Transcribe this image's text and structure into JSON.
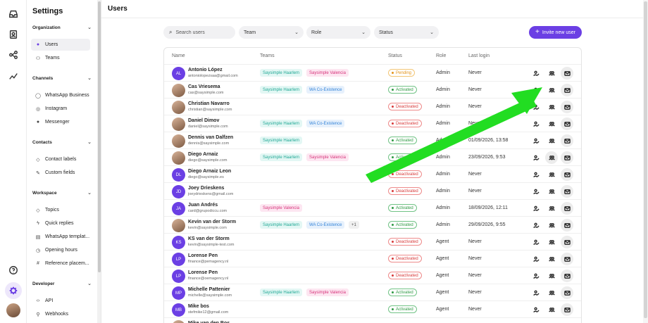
{
  "sidebar": {
    "title": "Settings",
    "sections": [
      {
        "label": "Organization",
        "items": [
          {
            "label": "Users",
            "icon": "user-icon"
          },
          {
            "label": "Teams",
            "icon": "team-icon"
          }
        ]
      },
      {
        "label": "Channels",
        "items": [
          {
            "label": "WhatsApp Business",
            "icon": "whatsapp-icon"
          },
          {
            "label": "Instagram",
            "icon": "instagram-icon"
          },
          {
            "label": "Messenger",
            "icon": "messenger-icon"
          }
        ]
      },
      {
        "label": "Contacts",
        "items": [
          {
            "label": "Contact labels",
            "icon": "tag-icon"
          },
          {
            "label": "Custom fields",
            "icon": "edit-icon"
          }
        ]
      },
      {
        "label": "Workspace",
        "items": [
          {
            "label": "Topics",
            "icon": "tag-icon"
          },
          {
            "label": "Quick replies",
            "icon": "bolt-icon"
          },
          {
            "label": "WhatsApp templat...",
            "icon": "template-icon"
          },
          {
            "label": "Opening hours",
            "icon": "clock-icon"
          },
          {
            "label": "Reference placem...",
            "icon": "hash-icon"
          }
        ]
      },
      {
        "label": "Developer",
        "items": [
          {
            "label": "API",
            "icon": "code-icon"
          },
          {
            "label": "Webhooks",
            "icon": "webhook-icon"
          }
        ]
      }
    ]
  },
  "main": {
    "title": "Users",
    "search_placeholder": "Search users",
    "filters": [
      "Team",
      "Role",
      "Status"
    ],
    "invite_label": "Invite new user",
    "columns": {
      "name": "Name",
      "teams": "Teams",
      "status": "Status",
      "role": "Role",
      "last_login": "Last login"
    }
  },
  "users": [
    {
      "initials": "AL",
      "photo": false,
      "name": "Antonio López",
      "email": "antoniolopezsaa@gmail.com",
      "teams": [
        {
          "label": "Saysimple Haarlem",
          "color": "teal"
        },
        {
          "label": "Saysimple Valencia",
          "color": "pink"
        }
      ],
      "status": "Pending",
      "status_kind": "pend",
      "role": "Admin",
      "last_login": "Never"
    },
    {
      "initials": "",
      "photo": true,
      "name": "Cas Vriesema",
      "email": "cas@saysimple.com",
      "teams": [
        {
          "label": "Saysimple Haarlem",
          "color": "teal"
        },
        {
          "label": "WA Co-Existence",
          "color": "blue"
        }
      ],
      "status": "Activated",
      "status_kind": "act",
      "role": "Admin",
      "last_login": "Never"
    },
    {
      "initials": "",
      "photo": true,
      "name": "Christian Navarro",
      "email": "christian@saysimple.com",
      "teams": [],
      "status": "Deactivated",
      "status_kind": "deact",
      "role": "Admin",
      "last_login": "Never"
    },
    {
      "initials": "",
      "photo": true,
      "name": "Daniel Dimov",
      "email": "daniel@saysimple.com",
      "teams": [
        {
          "label": "Saysimple Haarlem",
          "color": "teal"
        },
        {
          "label": "WA Co-Existence",
          "color": "blue"
        }
      ],
      "status": "Deactivated",
      "status_kind": "deact",
      "role": "Admin",
      "last_login": "Never"
    },
    {
      "initials": "",
      "photo": true,
      "name": "Dennis van Dalfzen",
      "email": "dennis@saysimple.com",
      "teams": [
        {
          "label": "Saysimple Haarlem",
          "color": "teal"
        }
      ],
      "status": "Activated",
      "status_kind": "act",
      "role": "Admin",
      "last_login": "01/09/2026, 13:58"
    },
    {
      "initials": "",
      "photo": true,
      "name": "Diego Arnaiz",
      "email": "diego@saysimple.com",
      "teams": [
        {
          "label": "Saysimple Haarlem",
          "color": "teal"
        },
        {
          "label": "Saysimple Valencia",
          "color": "pink"
        }
      ],
      "status": "Activated",
      "status_kind": "act",
      "role": "Admin",
      "last_login": "23/09/2026, 9:53"
    },
    {
      "initials": "DL",
      "photo": false,
      "name": "Diego Arnaiz Leon",
      "email": "diego@saysimple.es",
      "teams": [],
      "status": "Deactivated",
      "status_kind": "deact",
      "role": "Admin",
      "last_login": "Never"
    },
    {
      "initials": "JD",
      "photo": false,
      "name": "Joey Drieskens",
      "email": "joeydrieskens@gmail.com",
      "teams": [],
      "status": "Deactivated",
      "status_kind": "deact",
      "role": "Admin",
      "last_login": "Never"
    },
    {
      "initials": "JA",
      "photo": false,
      "name": "Juan Andrés",
      "email": "card@grupodiccu.com",
      "teams": [
        {
          "label": "Saysimple Valencia",
          "color": "pink"
        }
      ],
      "status": "Activated",
      "status_kind": "act",
      "role": "Admin",
      "last_login": "18/09/2026, 12:11"
    },
    {
      "initials": "",
      "photo": true,
      "name": "Kevin van der Storm",
      "email": "kevin@saysimple.com",
      "teams": [
        {
          "label": "Saysimple Haarlem",
          "color": "teal"
        },
        {
          "label": "WA Co-Existence",
          "color": "blue"
        },
        {
          "label": "+1",
          "color": "gray"
        }
      ],
      "status": "Activated",
      "status_kind": "act",
      "role": "Admin",
      "last_login": "29/09/2026, 9:55"
    },
    {
      "initials": "KS",
      "photo": false,
      "name": "KS van der Storm",
      "email": "kevin@saysimple-test.com",
      "teams": [],
      "status": "Deactivated",
      "status_kind": "deact",
      "role": "Agent",
      "last_login": "Never"
    },
    {
      "initials": "LP",
      "photo": false,
      "name": "Lorense Pen",
      "email": "finance@pemagency.nl",
      "teams": [],
      "status": "Deactivated",
      "status_kind": "deact",
      "role": "Agent",
      "last_login": "Never"
    },
    {
      "initials": "LP",
      "photo": false,
      "name": "Lorense Pen",
      "email": "finance@oemagency.nl",
      "teams": [],
      "status": "Deactivated",
      "status_kind": "deact",
      "role": "Agent",
      "last_login": "Never"
    },
    {
      "initials": "MP",
      "photo": false,
      "name": "Michelle Pattenier",
      "email": "michelle@saysimple.com",
      "teams": [
        {
          "label": "Saysimple Haarlem",
          "color": "teal"
        },
        {
          "label": "Saysimple Valencia",
          "color": "pink"
        }
      ],
      "status": "Activated",
      "status_kind": "act",
      "role": "Agent",
      "last_login": "Never"
    },
    {
      "initials": "MB",
      "photo": false,
      "name": "Mike bos",
      "email": "stefmike12@gmail.com",
      "teams": [],
      "status": "Activated",
      "status_kind": "act",
      "role": "Agent",
      "last_login": "Never"
    },
    {
      "initials": "",
      "photo": true,
      "name": "Mike van den Bos",
      "email": "",
      "teams": [],
      "status": "",
      "status_kind": "act",
      "role": "",
      "last_login": ""
    }
  ],
  "colors": {
    "accent": "#6b3fe4",
    "annotation_arrow": "#22dd22"
  }
}
